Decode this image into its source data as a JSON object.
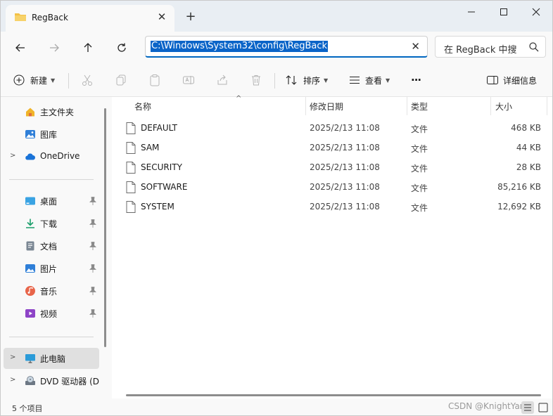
{
  "window": {
    "tab_title": "RegBack",
    "new_tab_symbol": "+",
    "close_tab_symbol": "✕"
  },
  "address": {
    "path": "C:\\Windows\\System32\\config\\RegBack",
    "clear_symbol": "✕",
    "search_placeholder": "在 RegBack 中搜"
  },
  "toolbar": {
    "new_label": "新建",
    "sort_label": "排序",
    "view_label": "查看",
    "more_label": "···",
    "details_label": "详细信息"
  },
  "sidebar": {
    "items": [
      {
        "label": "主文件夹",
        "icon": "home-icon"
      },
      {
        "label": "图库",
        "icon": "gallery-icon"
      },
      {
        "label": "OneDrive",
        "icon": "cloud-icon"
      },
      {
        "label": "桌面",
        "icon": "desktop-icon"
      },
      {
        "label": "下载",
        "icon": "download-icon"
      },
      {
        "label": "文档",
        "icon": "document-icon"
      },
      {
        "label": "图片",
        "icon": "picture-icon"
      },
      {
        "label": "音乐",
        "icon": "music-icon"
      },
      {
        "label": "视频",
        "icon": "video-icon"
      },
      {
        "label": "此电脑",
        "icon": "pc-icon"
      },
      {
        "label": "DVD 驱动器 (D",
        "icon": "dvd-icon"
      }
    ]
  },
  "columns": {
    "name": "名称",
    "date": "修改日期",
    "type": "类型",
    "size": "大小"
  },
  "files": [
    {
      "name": "DEFAULT",
      "date": "2025/2/13 11:08",
      "type": "文件",
      "size": "468 KB"
    },
    {
      "name": "SAM",
      "date": "2025/2/13 11:08",
      "type": "文件",
      "size": "44 KB"
    },
    {
      "name": "SECURITY",
      "date": "2025/2/13 11:08",
      "type": "文件",
      "size": "28 KB"
    },
    {
      "name": "SOFTWARE",
      "date": "2025/2/13 11:08",
      "type": "文件",
      "size": "85,216 KB"
    },
    {
      "name": "SYSTEM",
      "date": "2025/2/13 11:08",
      "type": "文件",
      "size": "12,692 KB"
    }
  ],
  "status": {
    "count": "5 个项目",
    "watermark": "CSDN @KnightYang"
  },
  "colors": {
    "accent": "#0067c0",
    "selection": "#0a64c8",
    "folder": "#f3c046"
  }
}
